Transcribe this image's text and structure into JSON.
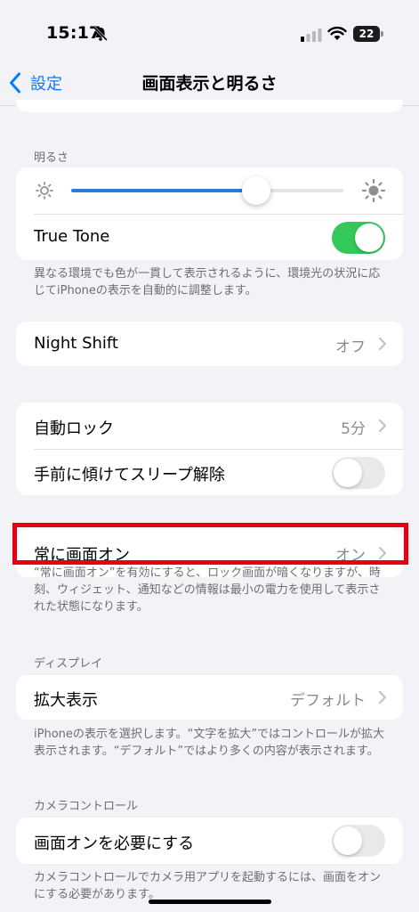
{
  "status_bar": {
    "time": "15:17",
    "battery": "22"
  },
  "nav": {
    "back_label": "設定",
    "title": "画面表示と明るさ"
  },
  "brightness": {
    "header": "明るさ",
    "level": 0.68,
    "true_tone_label": "True Tone",
    "true_tone_on": true,
    "footer": "異なる環境でも色が一貫して表示されるように、環境光の状況に応じてiPhoneの表示を自動的に調整します。"
  },
  "night_shift": {
    "label": "Night Shift",
    "value": "オフ"
  },
  "lock": {
    "auto_lock_label": "自動ロック",
    "auto_lock_value": "5分",
    "raise_to_wake_label": "手前に傾けてスリープ解除",
    "raise_to_wake_on": false
  },
  "always_on": {
    "label": "常に画面オン",
    "value": "オン",
    "footer": "“常に画面オン”を有効にすると、ロック画面が暗くなりますが、時刻、ウィジェット、通知などの情報は最小の電力を使用して表示された状態になります。"
  },
  "display": {
    "header": "ディスプレイ",
    "zoom_label": "拡大表示",
    "zoom_value": "デフォルト",
    "footer": "iPhoneの表示を選択します。“文字を拡大”ではコントロールが拡大表示されます。“デフォルト”ではより多くの内容が表示されます。"
  },
  "camera_control": {
    "header": "カメラコントロール",
    "require_screen_on_label": "画面オンを必要にする",
    "require_screen_on": false,
    "footer": "カメラコントロールでカメラ用アプリを起動するには、画面をオンにする必要があります。"
  },
  "colors": {
    "accent": "#0a7aff",
    "toggle_on": "#34c759",
    "highlight": "#e60012"
  }
}
